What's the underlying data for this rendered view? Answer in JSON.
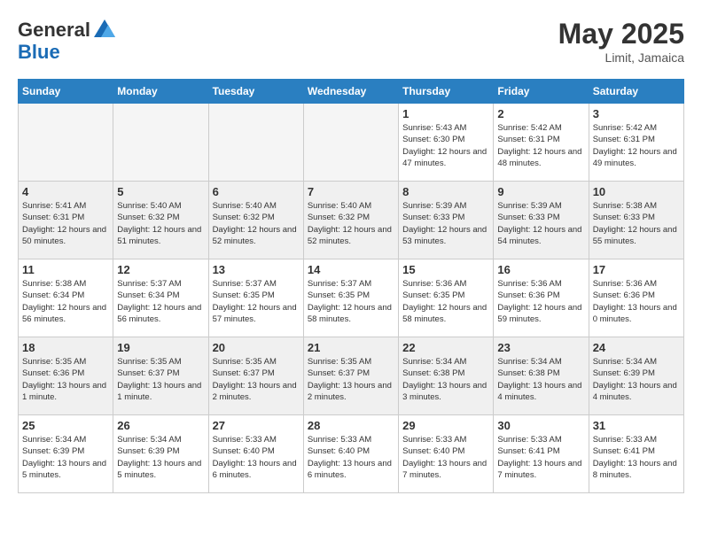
{
  "header": {
    "logo_general": "General",
    "logo_blue": "Blue",
    "month_year": "May 2025",
    "location": "Limit, Jamaica"
  },
  "days_of_week": [
    "Sunday",
    "Monday",
    "Tuesday",
    "Wednesday",
    "Thursday",
    "Friday",
    "Saturday"
  ],
  "weeks": [
    [
      {
        "day": "",
        "info": ""
      },
      {
        "day": "",
        "info": ""
      },
      {
        "day": "",
        "info": ""
      },
      {
        "day": "",
        "info": ""
      },
      {
        "day": "1",
        "info": "Sunrise: 5:43 AM\nSunset: 6:30 PM\nDaylight: 12 hours\nand 47 minutes."
      },
      {
        "day": "2",
        "info": "Sunrise: 5:42 AM\nSunset: 6:31 PM\nDaylight: 12 hours\nand 48 minutes."
      },
      {
        "day": "3",
        "info": "Sunrise: 5:42 AM\nSunset: 6:31 PM\nDaylight: 12 hours\nand 49 minutes."
      }
    ],
    [
      {
        "day": "4",
        "info": "Sunrise: 5:41 AM\nSunset: 6:31 PM\nDaylight: 12 hours\nand 50 minutes."
      },
      {
        "day": "5",
        "info": "Sunrise: 5:40 AM\nSunset: 6:32 PM\nDaylight: 12 hours\nand 51 minutes."
      },
      {
        "day": "6",
        "info": "Sunrise: 5:40 AM\nSunset: 6:32 PM\nDaylight: 12 hours\nand 52 minutes."
      },
      {
        "day": "7",
        "info": "Sunrise: 5:40 AM\nSunset: 6:32 PM\nDaylight: 12 hours\nand 52 minutes."
      },
      {
        "day": "8",
        "info": "Sunrise: 5:39 AM\nSunset: 6:33 PM\nDaylight: 12 hours\nand 53 minutes."
      },
      {
        "day": "9",
        "info": "Sunrise: 5:39 AM\nSunset: 6:33 PM\nDaylight: 12 hours\nand 54 minutes."
      },
      {
        "day": "10",
        "info": "Sunrise: 5:38 AM\nSunset: 6:33 PM\nDaylight: 12 hours\nand 55 minutes."
      }
    ],
    [
      {
        "day": "11",
        "info": "Sunrise: 5:38 AM\nSunset: 6:34 PM\nDaylight: 12 hours\nand 56 minutes."
      },
      {
        "day": "12",
        "info": "Sunrise: 5:37 AM\nSunset: 6:34 PM\nDaylight: 12 hours\nand 56 minutes."
      },
      {
        "day": "13",
        "info": "Sunrise: 5:37 AM\nSunset: 6:35 PM\nDaylight: 12 hours\nand 57 minutes."
      },
      {
        "day": "14",
        "info": "Sunrise: 5:37 AM\nSunset: 6:35 PM\nDaylight: 12 hours\nand 58 minutes."
      },
      {
        "day": "15",
        "info": "Sunrise: 5:36 AM\nSunset: 6:35 PM\nDaylight: 12 hours\nand 58 minutes."
      },
      {
        "day": "16",
        "info": "Sunrise: 5:36 AM\nSunset: 6:36 PM\nDaylight: 12 hours\nand 59 minutes."
      },
      {
        "day": "17",
        "info": "Sunrise: 5:36 AM\nSunset: 6:36 PM\nDaylight: 13 hours\nand 0 minutes."
      }
    ],
    [
      {
        "day": "18",
        "info": "Sunrise: 5:35 AM\nSunset: 6:36 PM\nDaylight: 13 hours\nand 1 minute."
      },
      {
        "day": "19",
        "info": "Sunrise: 5:35 AM\nSunset: 6:37 PM\nDaylight: 13 hours\nand 1 minute."
      },
      {
        "day": "20",
        "info": "Sunrise: 5:35 AM\nSunset: 6:37 PM\nDaylight: 13 hours\nand 2 minutes."
      },
      {
        "day": "21",
        "info": "Sunrise: 5:35 AM\nSunset: 6:37 PM\nDaylight: 13 hours\nand 2 minutes."
      },
      {
        "day": "22",
        "info": "Sunrise: 5:34 AM\nSunset: 6:38 PM\nDaylight: 13 hours\nand 3 minutes."
      },
      {
        "day": "23",
        "info": "Sunrise: 5:34 AM\nSunset: 6:38 PM\nDaylight: 13 hours\nand 4 minutes."
      },
      {
        "day": "24",
        "info": "Sunrise: 5:34 AM\nSunset: 6:39 PM\nDaylight: 13 hours\nand 4 minutes."
      }
    ],
    [
      {
        "day": "25",
        "info": "Sunrise: 5:34 AM\nSunset: 6:39 PM\nDaylight: 13 hours\nand 5 minutes."
      },
      {
        "day": "26",
        "info": "Sunrise: 5:34 AM\nSunset: 6:39 PM\nDaylight: 13 hours\nand 5 minutes."
      },
      {
        "day": "27",
        "info": "Sunrise: 5:33 AM\nSunset: 6:40 PM\nDaylight: 13 hours\nand 6 minutes."
      },
      {
        "day": "28",
        "info": "Sunrise: 5:33 AM\nSunset: 6:40 PM\nDaylight: 13 hours\nand 6 minutes."
      },
      {
        "day": "29",
        "info": "Sunrise: 5:33 AM\nSunset: 6:40 PM\nDaylight: 13 hours\nand 7 minutes."
      },
      {
        "day": "30",
        "info": "Sunrise: 5:33 AM\nSunset: 6:41 PM\nDaylight: 13 hours\nand 7 minutes."
      },
      {
        "day": "31",
        "info": "Sunrise: 5:33 AM\nSunset: 6:41 PM\nDaylight: 13 hours\nand 8 minutes."
      }
    ]
  ]
}
